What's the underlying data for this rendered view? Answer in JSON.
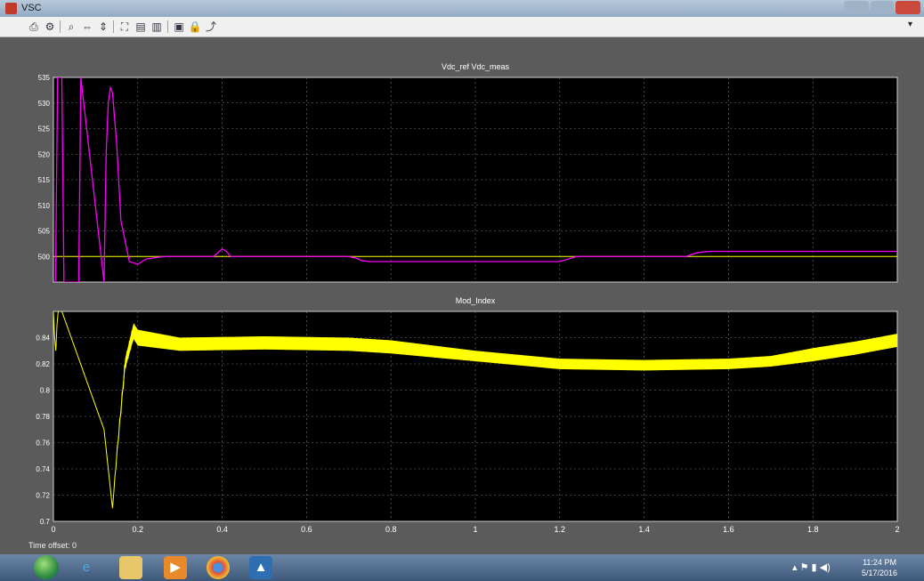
{
  "window": {
    "title": "VSC",
    "toolbar_icons": [
      "print-icon",
      "parameters-icon",
      "zoom-icon",
      "zoom-x-icon",
      "zoom-y-icon",
      "autoscale-icon",
      "save-axes-icon",
      "restore-axes-icon",
      "floating-scope-icon",
      "lock-icon",
      "signal-selection-icon"
    ]
  },
  "time_offset": "Time offset:  0",
  "taskbar": {
    "icons": [
      "start-icon",
      "ie-icon",
      "explorer-icon",
      "media-player-icon",
      "chrome-icon",
      "matlab-icon"
    ],
    "clock_time": "11:24 PM",
    "clock_date": "5/17/2016"
  },
  "colors": {
    "plot_bg": "#000000",
    "figure_bg": "#5b5b5b",
    "trace1": "#ff00ff",
    "trace2": "#ffff00",
    "reference": "#ffff00",
    "grid": "#7a7a7a",
    "tick_text": "#ffffff"
  },
  "chart_data": [
    {
      "type": "line",
      "title": "Vdc_ref  Vdc_meas",
      "xlim": [
        0,
        2
      ],
      "ylim": [
        495,
        535
      ],
      "x_ticks": [
        "0",
        "0.2",
        "0.4",
        "0.6",
        "0.8",
        "1",
        "1.2",
        "1.4",
        "1.6",
        "1.8",
        "2"
      ],
      "y_ticks": [
        "535",
        "530",
        "525",
        "520",
        "515",
        "510",
        "505",
        "500"
      ],
      "grid": true,
      "series": [
        {
          "color": "#ffff00",
          "x": [
            0,
            2
          ],
          "y": [
            500,
            500
          ]
        },
        {
          "color": "#ff00ff",
          "x": [
            0.005,
            0.01,
            0.02,
            0.025,
            0.06,
            0.065,
            0.12,
            0.125,
            0.13,
            0.135,
            0.14,
            0.15,
            0.16,
            0.18,
            0.2,
            0.22,
            0.26,
            0.3,
            0.38,
            0.4,
            0.41,
            0.42,
            0.44,
            0.5,
            0.7,
            0.72,
            0.73,
            0.75,
            1.0,
            1.2,
            1.24,
            1.3,
            1.5,
            1.52,
            1.54,
            1.56,
            1.7,
            2.0
          ],
          "y": [
            495,
            535,
            535,
            495,
            495,
            535,
            495,
            520,
            530,
            533,
            532,
            522,
            507,
            499,
            498.5,
            499.5,
            500,
            500,
            500,
            501.5,
            501,
            500,
            500,
            500,
            500,
            499.6,
            499.2,
            499,
            499,
            499,
            500,
            500,
            500,
            500.6,
            500.9,
            501,
            501,
            501
          ]
        }
      ]
    },
    {
      "type": "line",
      "title": "Mod_Index",
      "xlim": [
        0,
        2
      ],
      "ylim": [
        0.7,
        0.86
      ],
      "x_ticks": [
        "0",
        "0.2",
        "0.4",
        "0.6",
        "0.8",
        "1",
        "1.2",
        "1.4",
        "1.6",
        "1.8",
        "2"
      ],
      "y_ticks": [
        "0.84",
        "0.82",
        "0.8",
        "0.78",
        "0.76",
        "0.74",
        "0.72",
        "0.7"
      ],
      "grid": true,
      "series": [
        {
          "color": "#ffff00",
          "x": [
            0,
            0.005,
            0.01,
            0.02,
            0.12,
            0.14,
            0.15,
            0.17,
            0.19,
            0.2,
            0.3,
            0.5,
            0.7,
            0.8,
            1.0,
            1.2,
            1.4,
            1.6,
            1.7,
            1.8,
            1.9,
            2.0
          ],
          "y": [
            0.86,
            0.825,
            0.86,
            0.86,
            0.77,
            0.71,
            0.75,
            0.82,
            0.845,
            0.84,
            0.835,
            0.836,
            0.835,
            0.833,
            0.826,
            0.82,
            0.819,
            0.82,
            0.822,
            0.827,
            0.832,
            0.838
          ],
          "envelope_halfwidth": [
            0,
            0,
            0,
            0,
            0,
            0,
            0.002,
            0.004,
            0.006,
            0.006,
            0.005,
            0.005,
            0.005,
            0.005,
            0.004,
            0.004,
            0.004,
            0.004,
            0.004,
            0.005,
            0.005,
            0.005
          ]
        }
      ]
    }
  ]
}
